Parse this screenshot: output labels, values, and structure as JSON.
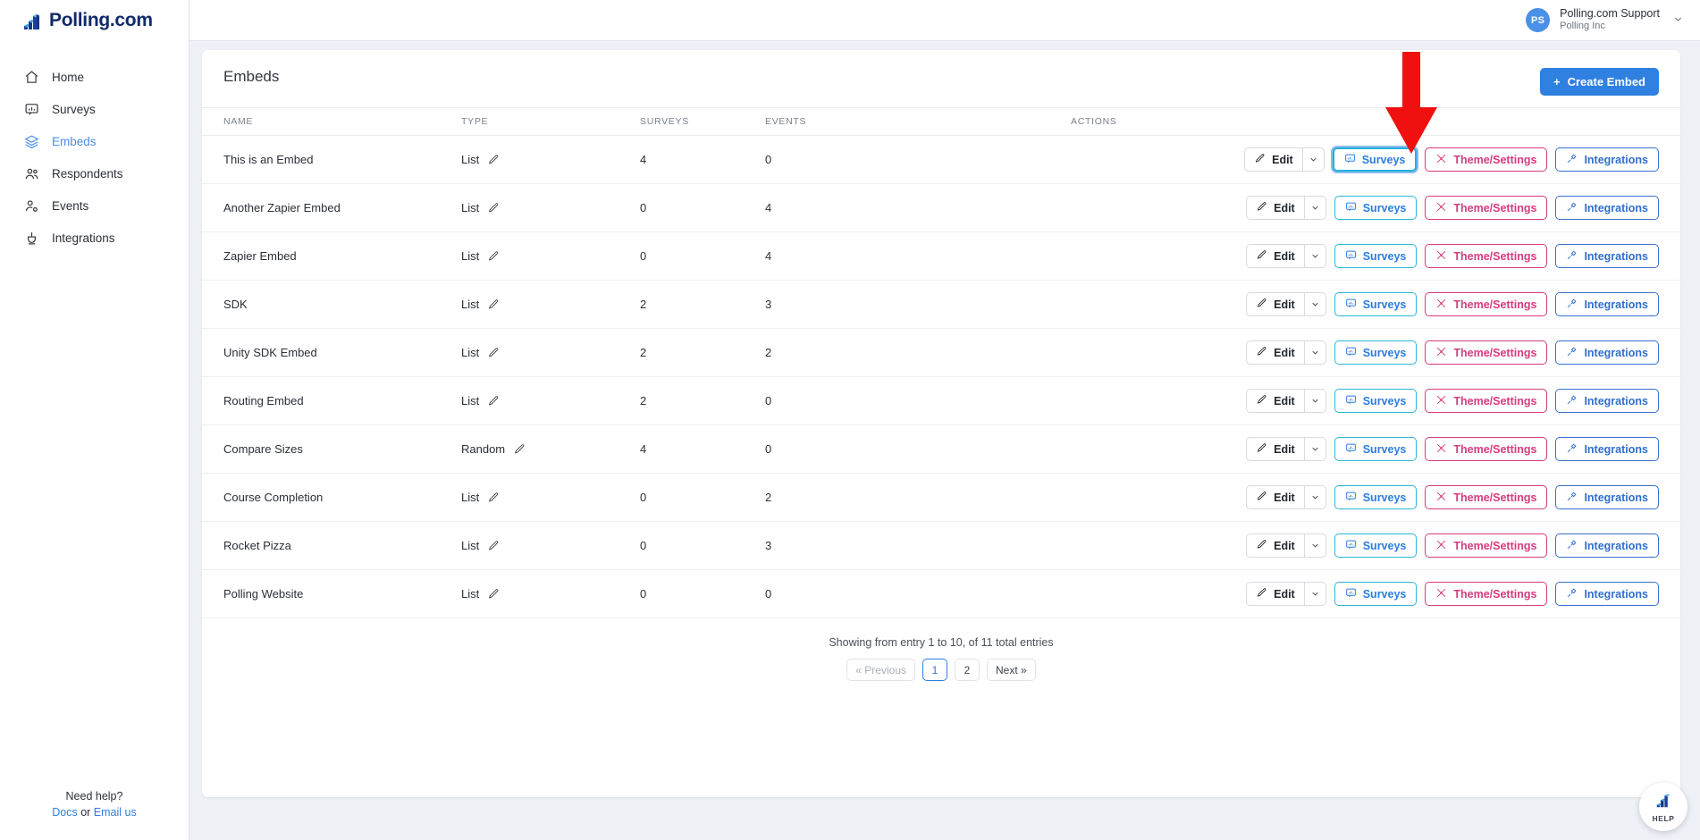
{
  "brand": {
    "name": "Polling.com",
    "icon": "bar-chart-logo-icon"
  },
  "sidebar": {
    "items": [
      {
        "label": "Home",
        "icon": "home-icon",
        "active": false
      },
      {
        "label": "Surveys",
        "icon": "survey-icon",
        "active": false
      },
      {
        "label": "Embeds",
        "icon": "layers-icon",
        "active": true
      },
      {
        "label": "Respondents",
        "icon": "users-icon",
        "active": false
      },
      {
        "label": "Events",
        "icon": "user-gear-icon",
        "active": false
      },
      {
        "label": "Integrations",
        "icon": "plug-icon",
        "active": false
      }
    ],
    "help": {
      "title": "Need help?",
      "docs": "Docs",
      "or": " or ",
      "email": "Email us"
    }
  },
  "topbar": {
    "user": {
      "initials": "PS",
      "name": "Polling.com Support",
      "org": "Polling Inc",
      "caret": "chevron-down-icon"
    }
  },
  "page": {
    "title": "Embeds",
    "create_button": {
      "label": "Create Embed",
      "plus": "+"
    }
  },
  "table": {
    "columns": [
      "NAME",
      "TYPE",
      "SURVEYS",
      "EVENTS",
      "ACTIONS"
    ],
    "row_actions": {
      "edit": "Edit",
      "edit_caret": "chevron-down-icon",
      "surveys": "Surveys",
      "theme": "Theme/Settings",
      "integrations": "Integrations"
    },
    "rows": [
      {
        "name": "This is an Embed",
        "type": "List",
        "surveys": "4",
        "events": "0",
        "highlight_surveys": true
      },
      {
        "name": "Another Zapier Embed",
        "type": "List",
        "surveys": "0",
        "events": "4",
        "highlight_surveys": false
      },
      {
        "name": "Zapier Embed",
        "type": "List",
        "surveys": "0",
        "events": "4",
        "highlight_surveys": false
      },
      {
        "name": "SDK",
        "type": "List",
        "surveys": "2",
        "events": "3",
        "highlight_surveys": false
      },
      {
        "name": "Unity SDK Embed",
        "type": "List",
        "surveys": "2",
        "events": "2",
        "highlight_surveys": false
      },
      {
        "name": "Routing Embed",
        "type": "List",
        "surveys": "2",
        "events": "0",
        "highlight_surveys": false
      },
      {
        "name": "Compare Sizes",
        "type": "Random",
        "surveys": "4",
        "events": "0",
        "highlight_surveys": false
      },
      {
        "name": "Course Completion",
        "type": "List",
        "surveys": "0",
        "events": "2",
        "highlight_surveys": false
      },
      {
        "name": "Rocket Pizza",
        "type": "List",
        "surveys": "0",
        "events": "3",
        "highlight_surveys": false
      },
      {
        "name": "Polling Website",
        "type": "List",
        "surveys": "0",
        "events": "0",
        "highlight_surveys": false
      }
    ]
  },
  "pagination": {
    "info": "Showing from entry 1 to 10, of 11 total entries",
    "previous": "« Previous",
    "pages": [
      "1",
      "2"
    ],
    "current_page": "1",
    "next": "Next »"
  },
  "help_widget": {
    "label": "HELP",
    "icon": "polling-logo-icon"
  },
  "annotation": {
    "type": "red-arrow-down",
    "color": "#f01010",
    "points_to": "surveys-button-row-1"
  },
  "colors": {
    "accent_blue": "#2f80e0",
    "brand_navy": "#102a6b",
    "surveys_cyan": "#2bb8d4",
    "theme_pink": "#d63b7e",
    "integrations_blue": "#3a6fd0",
    "page_bg": "#eef1f6"
  }
}
